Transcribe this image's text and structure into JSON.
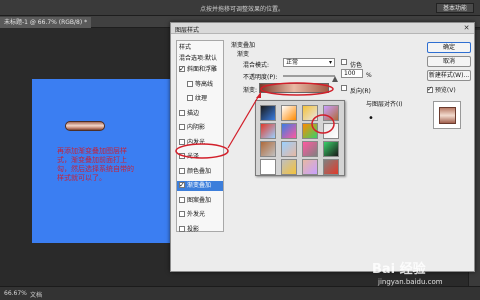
{
  "app": {
    "topbar_hint": "点按并拖移可调整效果的位置。",
    "workspace_button": "基本功能",
    "doc_tab": "未标题-1 @ 66.7% (RGB/8) *",
    "status_zoom": "66.67%",
    "status_doc": "文档"
  },
  "canvas": {
    "note": "再添加渐变叠加图层样式，渐变叠加前面打上勾，然后选择系统自带的样式就可以了。"
  },
  "dialog": {
    "title": "图层样式",
    "close_icon": "close-icon",
    "styles_header": "样式",
    "blend_options": "混合选项:默认",
    "style_items": [
      {
        "label": "斜面和浮雕",
        "checked": true,
        "active": false
      },
      {
        "label": "等高线",
        "checked": false,
        "active": false
      },
      {
        "label": "纹理",
        "checked": false,
        "active": false
      },
      {
        "label": "描边",
        "checked": false,
        "active": false
      },
      {
        "label": "内阴影",
        "checked": false,
        "active": false
      },
      {
        "label": "内发光",
        "checked": false,
        "active": false
      },
      {
        "label": "光泽",
        "checked": false,
        "active": false
      },
      {
        "label": "颜色叠加",
        "checked": false,
        "active": false
      },
      {
        "label": "渐变叠加",
        "checked": true,
        "active": true
      },
      {
        "label": "图案叠加",
        "checked": false,
        "active": false
      },
      {
        "label": "外发光",
        "checked": false,
        "active": false
      },
      {
        "label": "投影",
        "checked": false,
        "active": false
      }
    ],
    "section_title": "渐变叠加",
    "subsection_title": "渐变",
    "blend_mode_label": "混合模式:",
    "blend_mode_value": "正常",
    "dither_label": "仿色",
    "opacity_label": "不透明度(P):",
    "opacity_value": "100",
    "opacity_unit": "%",
    "gradient_label": "渐变:",
    "reverse_label": "反向(R)",
    "align_label": "与图层对齐(I)",
    "buttons": {
      "ok": "确定",
      "cancel": "取消",
      "new_style": "新建样式(W)...",
      "preview": "预览(V)"
    },
    "preview_checked": true,
    "gradient_presets": [
      "#1a1a1a",
      "#ffffff",
      "#f4c23a",
      "#c8a0ff",
      "#e23a2a",
      "#3a7de2",
      "#ff8a00",
      "#e6e6e6",
      "#b06a3a",
      "#9ad0ff",
      "#ff5aa0",
      "#3ad06a",
      "#ffffff",
      "#c0c0c0",
      "#e6b8a2",
      "#808080"
    ]
  },
  "watermark": {
    "brand": "Bai 经验",
    "url": "jingyan.baidu.com"
  }
}
